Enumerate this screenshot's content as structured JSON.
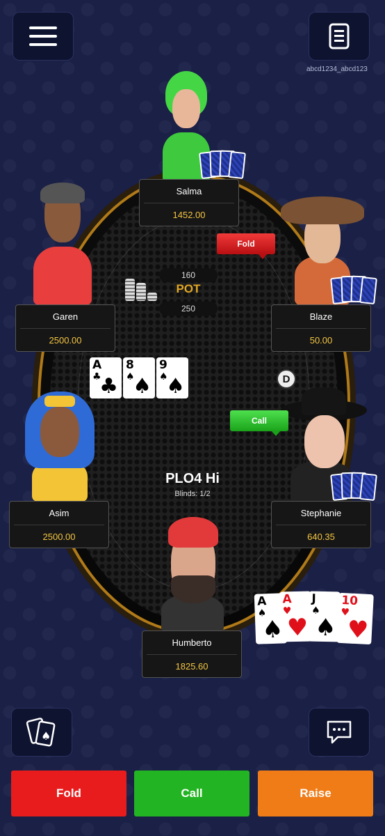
{
  "header": {
    "menu_icon": "hamburger-menu-icon",
    "history_icon": "hand-history-icon",
    "user_id": "abcd1234_abcd123"
  },
  "table": {
    "game": "PLO4 Hi",
    "blinds": "Blinds: 1/2",
    "pot_label": "POT",
    "pot_top": "160",
    "pot_bottom": "250",
    "dealer_button": "D"
  },
  "players": [
    {
      "name": "Salma",
      "stack": "1452.00"
    },
    {
      "name": "Garen",
      "stack": "2500.00"
    },
    {
      "name": "Blaze",
      "stack": "50.00"
    },
    {
      "name": "Asim",
      "stack": "2500.00"
    },
    {
      "name": "Stephanie",
      "stack": "640.35"
    },
    {
      "name": "Humberto",
      "stack": "1825.60"
    }
  ],
  "bubbles": {
    "salma_action": "Fold",
    "stephanie_action": "Call"
  },
  "board": [
    {
      "rank": "A",
      "suit": "♣",
      "color": "#000000"
    },
    {
      "rank": "8",
      "suit": "♠",
      "color": "#000000"
    },
    {
      "rank": "9",
      "suit": "♠",
      "color": "#000000"
    }
  ],
  "hero_cards": [
    {
      "rank": "A",
      "suit": "♠",
      "color": "#000000"
    },
    {
      "rank": "A",
      "suit": "♥",
      "color": "#e0101b"
    },
    {
      "rank": "J",
      "suit": "♠",
      "color": "#000000"
    },
    {
      "rank": "10",
      "suit": "♥",
      "color": "#e0101b"
    }
  ],
  "actions": {
    "fold": "Fold",
    "call": "Call",
    "raise": "Raise",
    "fold_color": "#e81c1c",
    "call_color": "#22b422",
    "raise_color": "#f07c18"
  },
  "footer": {
    "cards_icon": "card-spade-icon",
    "chat_icon": "chat-bubble-icon"
  }
}
